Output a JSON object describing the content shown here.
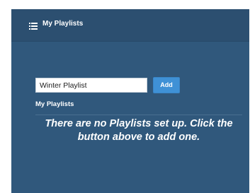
{
  "panel": {
    "title": "My Playlists",
    "header_icon": "list-icon"
  },
  "form": {
    "input_value": "Winter Playlist",
    "add_label": "Add"
  },
  "playlists": {
    "section_title": "My Playlists",
    "empty_message": "There are no Playlists set up. Click the button above to add one."
  },
  "colors": {
    "panel_bg": "#30587c",
    "header_bg": "#2c4f70",
    "button_bg": "#3f91d6",
    "text": "#ffffff"
  }
}
